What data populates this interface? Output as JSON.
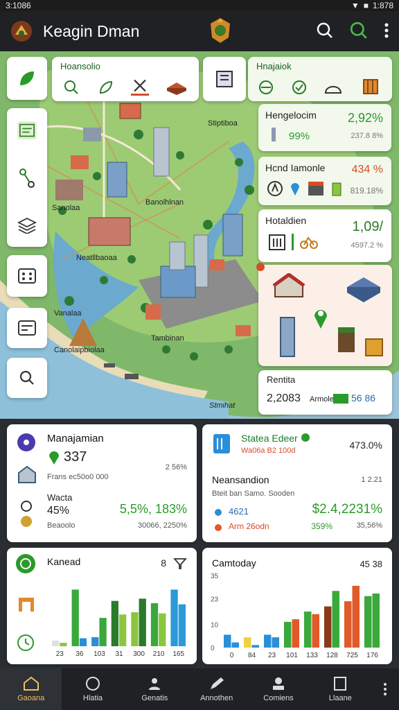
{
  "status": {
    "time": "3:1086",
    "clock": "1:878"
  },
  "app": {
    "title": "Keagin Dman"
  },
  "map": {
    "tabs_left": {
      "title": "Hoansolio"
    },
    "tabs_right": {
      "title": "Hnajaiok"
    },
    "labels": [
      "Stiptiboa",
      "Sanolaa",
      "Banolhlnan",
      "Neatllbaoaa",
      "Vanalaa",
      "Canolaipbiolaa",
      "Tambinan",
      "Stmihat"
    ],
    "chips": [
      {
        "name": "Hengelocim",
        "pct": "2,92%",
        "sub": "99%",
        "sub2": "237.8 8%"
      },
      {
        "name": "Hcnd Iamonle",
        "pct": "434 %",
        "sub2": "819.18%"
      },
      {
        "name": "Hotaldien",
        "pct": "1,09/",
        "sub2": "4597.2 %"
      }
    ],
    "info": {
      "title": "Rentita",
      "value": "2,2083",
      "unit": "Armole",
      "codes": "56 86"
    }
  },
  "cards": {
    "management": {
      "title": "Manajamian",
      "value": "337",
      "pct": "2 56%",
      "desc": "Frans ec50o0 000",
      "sub_title": "Wacta",
      "sub_value": "45%",
      "sub_pct": "5,5%, 183%",
      "sub_desc": "Beaoolo",
      "sub_desc2": "30066, 2250%"
    },
    "station": {
      "title": "Statea Edeer",
      "subtitle": "Wa06a B2 100d",
      "pct": "473.0%",
      "list_title": "Neansandion",
      "list_pct": "1 2.21",
      "list_desc": "Bteit ban Samo. Sooden",
      "row1_label": "4621",
      "row1_value": "$2.4,2231%",
      "row2_label": "Arm 26odn",
      "row2_value": "359%",
      "row2_extra": "35,56%"
    },
    "chart_left": {
      "title": "Kanead",
      "badge": "8"
    },
    "chart_right": {
      "title": "Camtoday",
      "badge": "45 38"
    }
  },
  "chart_data": [
    {
      "type": "bar",
      "title": "Kanead",
      "categories": [
        "23",
        "36",
        "103",
        "31",
        "300",
        "210",
        "165"
      ],
      "series": [
        {
          "values": [
            5,
            50,
            8,
            40,
            30,
            38,
            50
          ]
        },
        {
          "values": [
            3,
            7,
            25,
            28,
            42,
            29,
            37
          ]
        }
      ],
      "ylim": [
        0,
        60
      ]
    },
    {
      "type": "bar",
      "title": "Camtoday",
      "categories": [
        "0",
        "84",
        "23",
        "101",
        "133",
        "128",
        "725",
        "176"
      ],
      "y_ticks": [
        "35",
        "23",
        "10",
        "0"
      ],
      "series": [
        {
          "values": [
            5,
            4,
            5,
            10,
            14,
            16,
            18,
            20
          ]
        },
        {
          "values": [
            2,
            1,
            4,
            11,
            13,
            22,
            24,
            21
          ]
        }
      ],
      "ylim": [
        0,
        28
      ]
    }
  ],
  "nav": [
    "Gaoana",
    "Hlatia",
    "Genatis",
    "Annothen",
    "Comiens",
    "Llaane"
  ],
  "colors": {
    "accent": "#2a9a2a",
    "bar_green": "#3aa83a",
    "bar_blue": "#2a8fd8",
    "bar_red": "#e05a2a",
    "bar_lime": "#8cc63f"
  }
}
